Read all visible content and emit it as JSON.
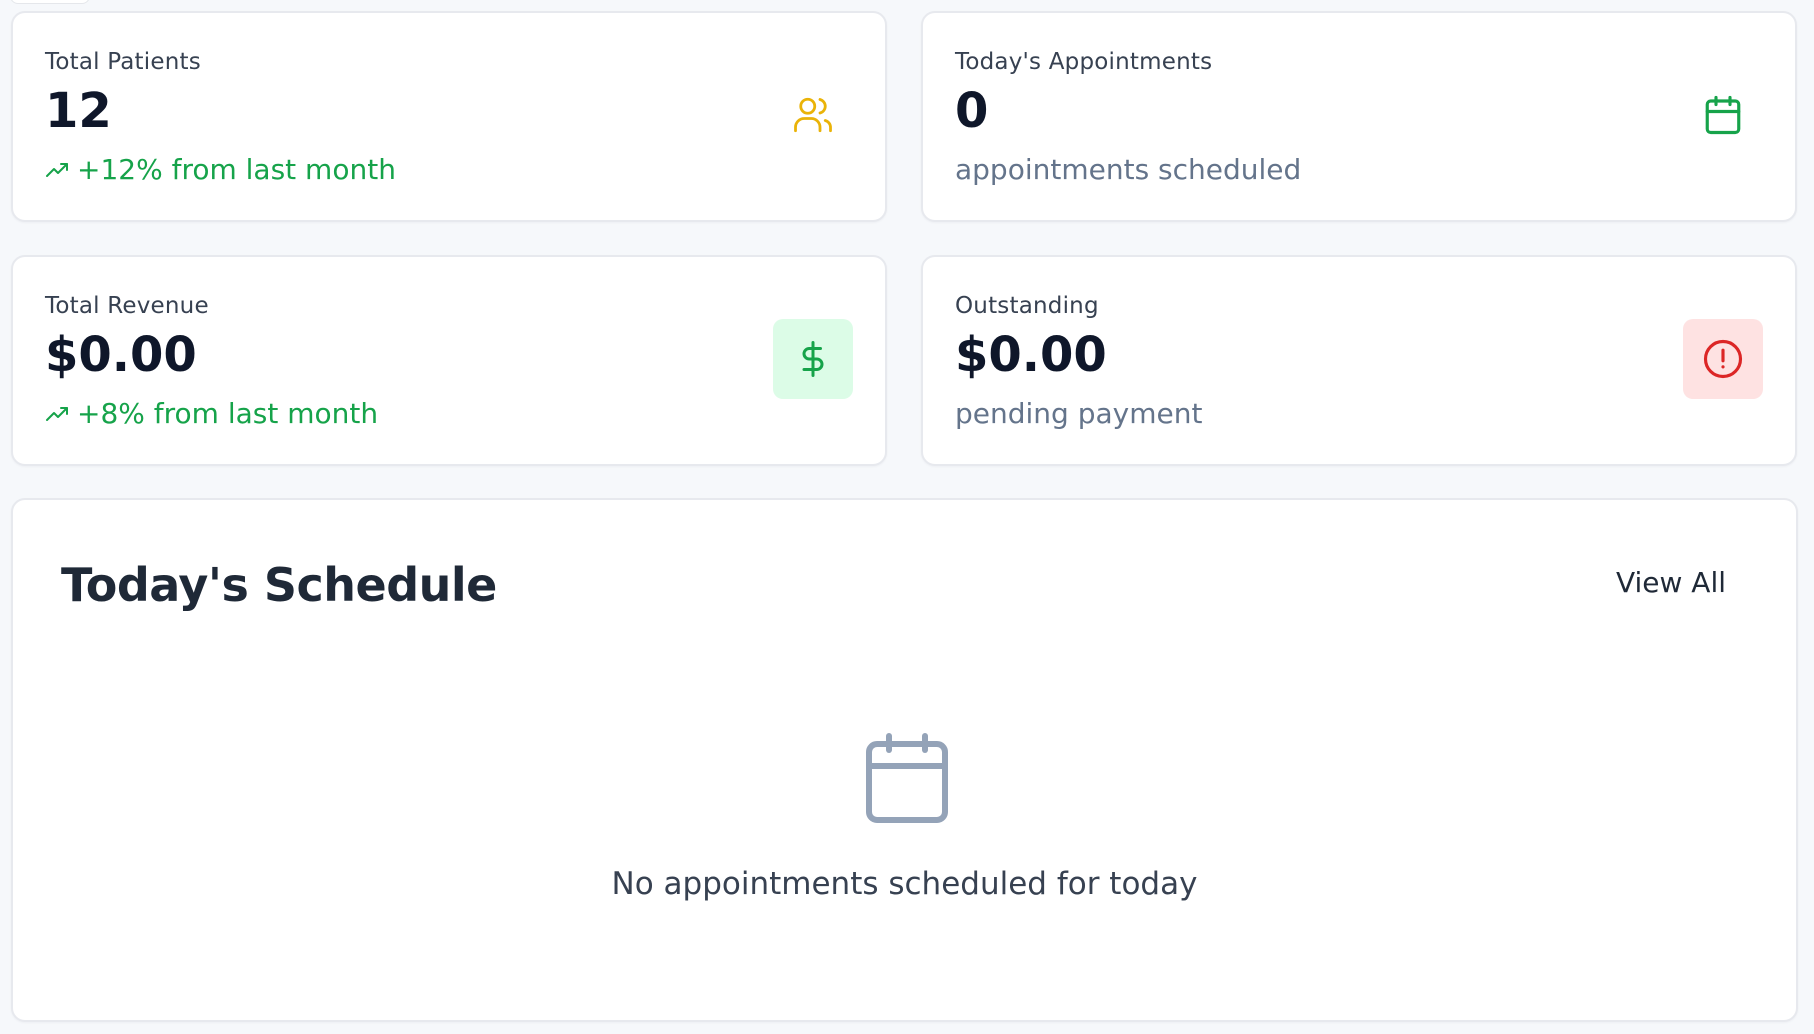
{
  "stats": [
    {
      "label": "Total Patients",
      "value": "12",
      "sub": "+12% from last month",
      "icon": "users-icon",
      "icon_color": "#eab308"
    },
    {
      "label": "Today's Appointments",
      "value": "0",
      "sub": "appointments scheduled",
      "icon": "calendar-icon",
      "icon_color": "#16a34a"
    },
    {
      "label": "Total Revenue",
      "value": "$0.00",
      "sub": "+8% from last month",
      "icon": "dollar-icon",
      "icon_color": "#16a34a",
      "icon_bg": "#dcfce7"
    },
    {
      "label": "Outstanding",
      "value": "$0.00",
      "sub": "pending payment",
      "icon": "alert-circle-icon",
      "icon_color": "#dc2626",
      "icon_bg": "#fee2e2"
    }
  ],
  "schedule": {
    "title": "Today's Schedule",
    "view_all_label": "View All",
    "empty_message": "No appointments scheduled for today",
    "empty_icon": "calendar-icon",
    "empty_icon_color": "#94a3b8"
  },
  "colors": {
    "trend_up": "#16a34a",
    "muted_text": "#64748b",
    "background": "#f6f8fb"
  }
}
